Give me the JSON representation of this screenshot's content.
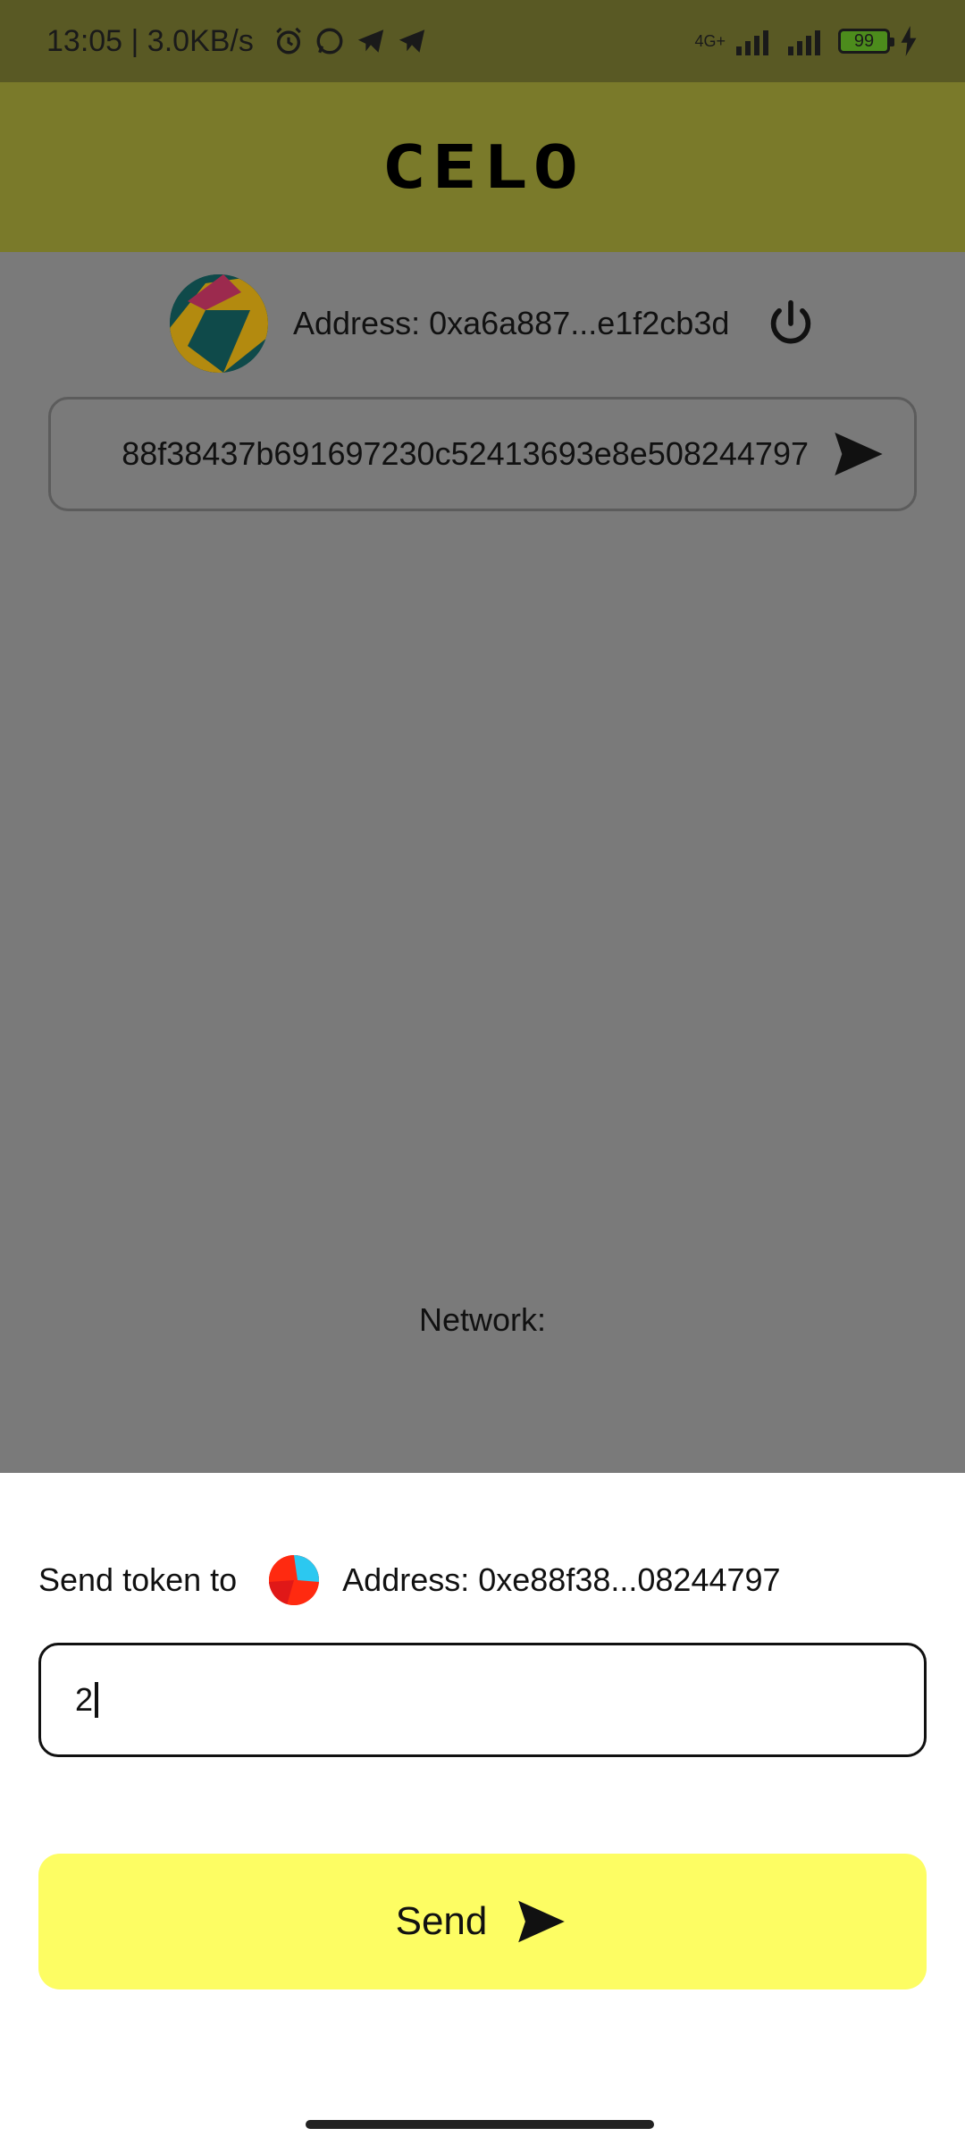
{
  "status_bar": {
    "time_speed": "13:05 | 3.0KB/s",
    "icons": [
      "alarm-icon",
      "whatsapp-icon",
      "telegram-icon",
      "telegram-icon"
    ],
    "network_type": "4G+",
    "battery": "99"
  },
  "app": {
    "logo_text": "CeLO"
  },
  "account": {
    "address": "Address: 0xa6a887...e1f2cb3d"
  },
  "recipient_input": {
    "value": "88f38437b691697230c52413693e8e508244797"
  },
  "network": {
    "label": "Network:"
  },
  "sheet": {
    "title": "Send token to",
    "address": "Address: 0xe88f38...08244797",
    "amount_value": "2",
    "send_label": "Send"
  },
  "colors": {
    "send_button": "#fdfd63",
    "app_bar": "#7a7a2a",
    "scrim": "#7a7a7a"
  }
}
